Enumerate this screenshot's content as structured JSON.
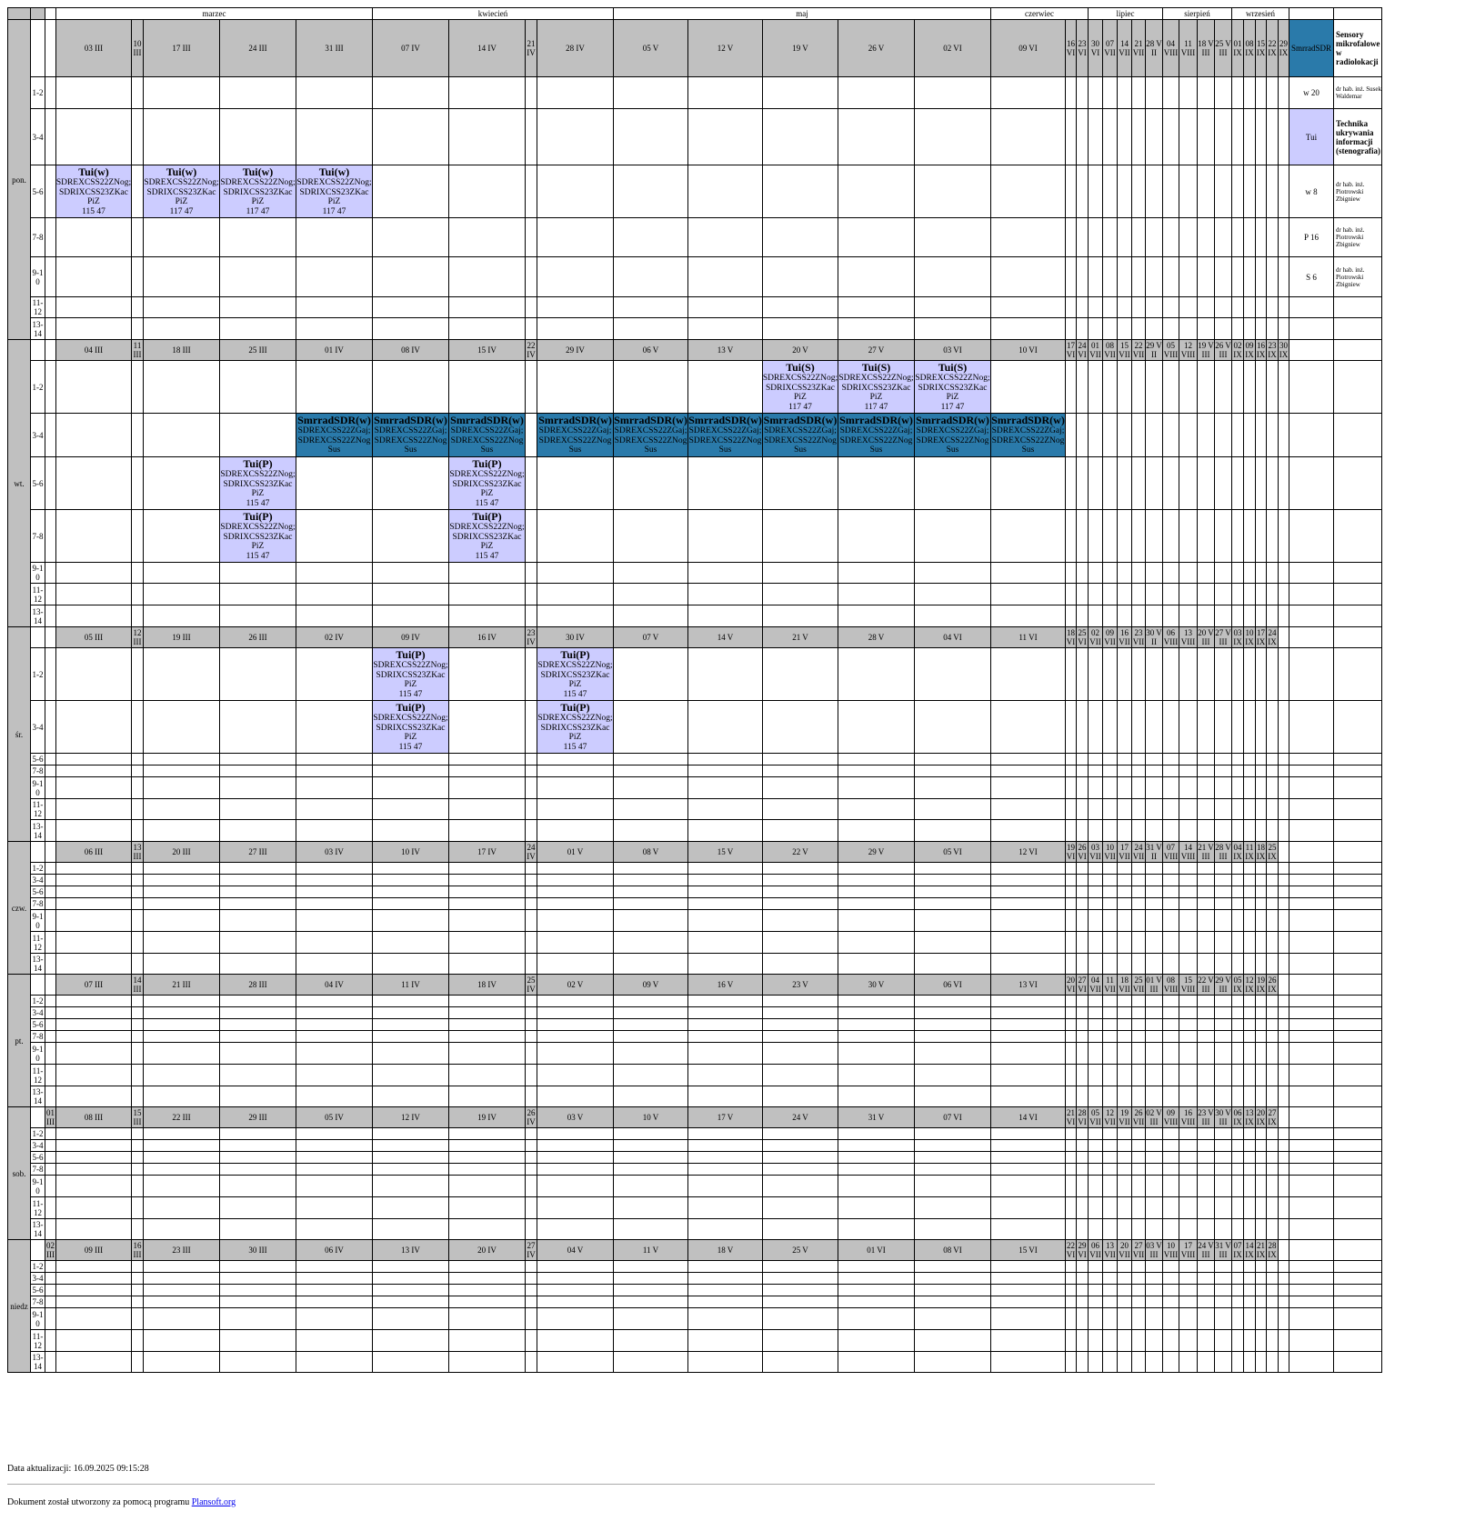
{
  "months": [
    "marzec",
    "kwiecień",
    "maj",
    "czerwiec",
    "lipiec",
    "sierpień",
    "wrzesień"
  ],
  "days": [
    {
      "name": "pon.",
      "dates": [
        "",
        "03 III",
        "10 III",
        "17 III",
        "24 III",
        "31 III",
        "07 IV",
        "14 IV",
        "21 IV",
        "28 IV",
        "05 V",
        "12 V",
        "19 V",
        "26 V",
        "02 VI",
        "09 VI",
        "16 VI",
        "23 VI",
        "30 VI",
        "07 VII",
        "14 VII",
        "21 VII",
        "28 VII",
        "04 VIII",
        "11 VIII",
        "18 VIII",
        "25 VIII",
        "01 IX",
        "08 IX",
        "15 IX",
        "22 IX",
        "29 IX"
      ]
    },
    {
      "name": "wt.",
      "dates": [
        "",
        "04 III",
        "11 III",
        "18 III",
        "25 III",
        "01 IV",
        "08 IV",
        "15 IV",
        "22 IV",
        "29 IV",
        "06 V",
        "13 V",
        "20 V",
        "27 V",
        "03 VI",
        "10 VI",
        "17 VI",
        "24 VI",
        "01 VII",
        "08 VII",
        "15 VII",
        "22 VII",
        "29 VII",
        "05 VIII",
        "12 VIII",
        "19 VIII",
        "26 VIII",
        "02 IX",
        "09 IX",
        "16 IX",
        "23 IX",
        "30 IX"
      ]
    },
    {
      "name": "śr.",
      "dates": [
        "",
        "05 III",
        "12 III",
        "19 III",
        "26 III",
        "02 IV",
        "09 IV",
        "16 IV",
        "23 IV",
        "30 IV",
        "07 V",
        "14 V",
        "21 V",
        "28 V",
        "04 VI",
        "11 VI",
        "18 VI",
        "25 VI",
        "02 VII",
        "09 VII",
        "16 VII",
        "23 VII",
        "30 VII",
        "06 VIII",
        "13 VIII",
        "20 VIII",
        "27 VIII",
        "03 IX",
        "10 IX",
        "17 IX",
        "24 IX",
        ""
      ]
    },
    {
      "name": "czw.",
      "dates": [
        "",
        "06 III",
        "13 III",
        "20 III",
        "27 III",
        "03 IV",
        "10 IV",
        "17 IV",
        "24 IV",
        "01 V",
        "08 V",
        "15 V",
        "22 V",
        "29 V",
        "05 VI",
        "12 VI",
        "19 VI",
        "26 VI",
        "03 VII",
        "10 VII",
        "17 VII",
        "24 VII",
        "31 VII",
        "07 VIII",
        "14 VIII",
        "21 VIII",
        "28 VIII",
        "04 IX",
        "11 IX",
        "18 IX",
        "25 IX",
        ""
      ]
    },
    {
      "name": "pt.",
      "dates": [
        "",
        "07 III",
        "14 III",
        "21 III",
        "28 III",
        "04 IV",
        "11 IV",
        "18 IV",
        "25 IV",
        "02 V",
        "09 V",
        "16 V",
        "23 V",
        "30 V",
        "06 VI",
        "13 VI",
        "20 VI",
        "27 VI",
        "04 VII",
        "11 VII",
        "18 VII",
        "25 VII",
        "01 VIII",
        "08 VIII",
        "15 VIII",
        "22 VIII",
        "29 VIII",
        "05 IX",
        "12 IX",
        "19 IX",
        "26 IX",
        ""
      ]
    },
    {
      "name": "sob.",
      "dates": [
        "01 III",
        "08 III",
        "15 III",
        "22 III",
        "29 III",
        "05 IV",
        "12 IV",
        "19 IV",
        "26 IV",
        "03 V",
        "10 V",
        "17 V",
        "24 V",
        "31 V",
        "07 VI",
        "14 VI",
        "21 VI",
        "28 VI",
        "05 VII",
        "12 VII",
        "19 VII",
        "26 VII",
        "02 VIII",
        "09 VIII",
        "16 VIII",
        "23 VIII",
        "30 VIII",
        "06 IX",
        "13 IX",
        "20 IX",
        "27 IX",
        ""
      ]
    },
    {
      "name": "niedz",
      "dates": [
        "02 III",
        "09 III",
        "16 III",
        "23 III",
        "30 III",
        "06 IV",
        "13 IV",
        "20 IV",
        "27 IV",
        "04 V",
        "11 V",
        "18 V",
        "25 V",
        "01 VI",
        "08 VI",
        "15 VI",
        "22 VI",
        "29 VI",
        "06 VII",
        "13 VII",
        "20 VII",
        "27 VII",
        "03 VIII",
        "10 VIII",
        "17 VIII",
        "24 VIII",
        "31 VIII",
        "07 IX",
        "14 IX",
        "21 IX",
        "28 IX",
        ""
      ]
    }
  ],
  "slots": [
    "1-2",
    "3-4",
    "5-6",
    "7-8",
    "9-10",
    "11-12",
    "13-14"
  ],
  "events": [
    {
      "day": 0,
      "slot": 2,
      "col": 1,
      "kind": "tui",
      "lines": [
        "Tui(w)",
        "SDREXCSS22ZNog;",
        "SDRIXCSS23ZKac",
        "PiZ",
        "115 47"
      ]
    },
    {
      "day": 0,
      "slot": 2,
      "col": 3,
      "kind": "tui",
      "lines": [
        "Tui(w)",
        "SDREXCSS22ZNog;",
        "SDRIXCSS23ZKac",
        "PiZ",
        "117 47"
      ]
    },
    {
      "day": 0,
      "slot": 2,
      "col": 4,
      "kind": "tui",
      "lines": [
        "Tui(w)",
        "SDREXCSS22ZNog;",
        "SDRIXCSS23ZKac",
        "PiZ",
        "117 47"
      ]
    },
    {
      "day": 0,
      "slot": 2,
      "col": 5,
      "kind": "tui",
      "lines": [
        "Tui(w)",
        "SDREXCSS22ZNog;",
        "SDRIXCSS23ZKac",
        "PiZ",
        "117 47"
      ]
    },
    {
      "day": 1,
      "slot": 0,
      "col": 12,
      "kind": "tui",
      "lines": [
        "Tui(S)",
        "SDREXCSS22ZNog;",
        "SDRIXCSS23ZKac",
        "PiZ",
        "117 47"
      ]
    },
    {
      "day": 1,
      "slot": 0,
      "col": 13,
      "kind": "tui",
      "lines": [
        "Tui(S)",
        "SDREXCSS22ZNog;",
        "SDRIXCSS23ZKac",
        "PiZ",
        "117 47"
      ]
    },
    {
      "day": 1,
      "slot": 0,
      "col": 14,
      "kind": "tui",
      "lines": [
        "Tui(S)",
        "SDREXCSS22ZNog;",
        "SDRIXCSS23ZKac",
        "PiZ",
        "117 47"
      ]
    },
    {
      "day": 1,
      "slot": 1,
      "col": 5,
      "kind": "smr",
      "lines": [
        "SmrradSDR(w)",
        "SDREXCSS22ZGaj;",
        "SDREXCSS22ZNog",
        "Sus"
      ]
    },
    {
      "day": 1,
      "slot": 1,
      "col": 6,
      "kind": "smr",
      "lines": [
        "SmrradSDR(w)",
        "SDREXCSS22ZGaj;",
        "SDREXCSS22ZNog",
        "Sus"
      ]
    },
    {
      "day": 1,
      "slot": 1,
      "col": 7,
      "kind": "smr",
      "lines": [
        "SmrradSDR(w)",
        "SDREXCSS22ZGaj;",
        "SDREXCSS22ZNog",
        "Sus"
      ]
    },
    {
      "day": 1,
      "slot": 1,
      "col": 9,
      "kind": "smr",
      "lines": [
        "SmrradSDR(w)",
        "SDREXCSS22ZGaj;",
        "SDREXCSS22ZNog",
        "Sus"
      ]
    },
    {
      "day": 1,
      "slot": 1,
      "col": 10,
      "kind": "smr",
      "lines": [
        "SmrradSDR(w)",
        "SDREXCSS22ZGaj;",
        "SDREXCSS22ZNog",
        "Sus"
      ]
    },
    {
      "day": 1,
      "slot": 1,
      "col": 11,
      "kind": "smr",
      "lines": [
        "SmrradSDR(w)",
        "SDREXCSS22ZGaj;",
        "SDREXCSS22ZNog",
        "Sus"
      ]
    },
    {
      "day": 1,
      "slot": 1,
      "col": 12,
      "kind": "smr",
      "lines": [
        "SmrradSDR(w)",
        "SDREXCSS22ZGaj;",
        "SDREXCSS22ZNog",
        "Sus"
      ]
    },
    {
      "day": 1,
      "slot": 1,
      "col": 13,
      "kind": "smr",
      "lines": [
        "SmrradSDR(w)",
        "SDREXCSS22ZGaj;",
        "SDREXCSS22ZNog",
        "Sus"
      ]
    },
    {
      "day": 1,
      "slot": 1,
      "col": 14,
      "kind": "smr",
      "lines": [
        "SmrradSDR(w)",
        "SDREXCSS22ZGaj;",
        "SDREXCSS22ZNog",
        "Sus"
      ]
    },
    {
      "day": 1,
      "slot": 1,
      "col": 15,
      "kind": "smr",
      "lines": [
        "SmrradSDR(w)",
        "SDREXCSS22ZGaj;",
        "SDREXCSS22ZNog",
        "Sus"
      ]
    },
    {
      "day": 1,
      "slot": 2,
      "col": 4,
      "kind": "tui",
      "lines": [
        "Tui(P)",
        "SDREXCSS22ZNog;",
        "SDRIXCSS23ZKac",
        "PiZ",
        "115 47"
      ]
    },
    {
      "day": 1,
      "slot": 2,
      "col": 7,
      "kind": "tui",
      "lines": [
        "Tui(P)",
        "SDREXCSS22ZNog;",
        "SDRIXCSS23ZKac",
        "PiZ",
        "115 47"
      ]
    },
    {
      "day": 1,
      "slot": 3,
      "col": 4,
      "kind": "tui",
      "lines": [
        "Tui(P)",
        "SDREXCSS22ZNog;",
        "SDRIXCSS23ZKac",
        "PiZ",
        "115 47"
      ]
    },
    {
      "day": 1,
      "slot": 3,
      "col": 7,
      "kind": "tui",
      "lines": [
        "Tui(P)",
        "SDREXCSS22ZNog;",
        "SDRIXCSS23ZKac",
        "PiZ",
        "115 47"
      ]
    },
    {
      "day": 2,
      "slot": 0,
      "col": 6,
      "kind": "tui",
      "lines": [
        "Tui(P)",
        "SDREXCSS22ZNog;",
        "SDRIXCSS23ZKac",
        "PiZ",
        "115 47"
      ]
    },
    {
      "day": 2,
      "slot": 0,
      "col": 9,
      "kind": "tui",
      "lines": [
        "Tui(P)",
        "SDREXCSS22ZNog;",
        "SDRIXCSS23ZKac",
        "PiZ",
        "115 47"
      ]
    },
    {
      "day": 2,
      "slot": 1,
      "col": 6,
      "kind": "tui",
      "lines": [
        "Tui(P)",
        "SDREXCSS22ZNog;",
        "SDRIXCSS23ZKac",
        "PiZ",
        "115 47"
      ]
    },
    {
      "day": 2,
      "slot": 1,
      "col": 9,
      "kind": "tui",
      "lines": [
        "Tui(P)",
        "SDREXCSS22ZNog;",
        "SDRIXCSS23ZKac",
        "PiZ",
        "115 47"
      ]
    }
  ],
  "legend": {
    "header_code": "SmrradSDR",
    "header_name": "Sensory mikrofalowe w radiolokacji",
    "rows": [
      {
        "code": "w 20",
        "text": "dr hab. inż. Susek Waldemar",
        "kind": "plain"
      },
      {
        "code": "Tui",
        "text": "Technika ukrywania informacji (stenografia)",
        "kind": "tui"
      },
      {
        "code": "w 8",
        "text": "dr hab. inż. Piotrowski Zbigniew",
        "kind": "plain"
      },
      {
        "code": "P 16",
        "text": "dr hab. inż. Piotrowski Zbigniew",
        "kind": "plain"
      },
      {
        "code": "S 6",
        "text": "dr hab. inż. Piotrowski Zbigniew",
        "kind": "plain"
      }
    ]
  },
  "colors": {
    "date_header": "#c0c0c0",
    "tui": "#ccccff",
    "smrrad": "#2a7aaa"
  },
  "footer": {
    "updated": "Data aktualizacji: 16.09.2025 09:15:28",
    "created_prefix": "Dokument został utworzony za pomocą programu",
    "link": "Plansoft.org"
  }
}
